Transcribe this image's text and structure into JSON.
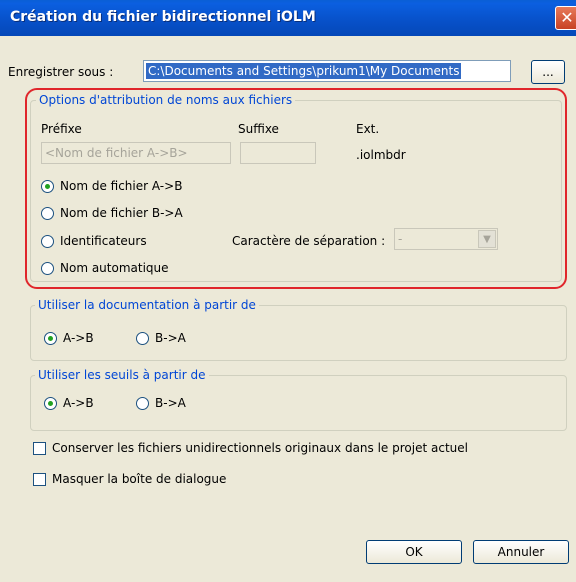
{
  "window": {
    "title": "Création du fichier bidirectionnel iOLM",
    "close_glyph": "✕"
  },
  "save": {
    "label": "Enregistrer sous :",
    "path": "C:\\Documents and Settings\\prikum1\\My Documents",
    "browse_label": "..."
  },
  "naming": {
    "legend": "Options d'attribution de noms aux fichiers",
    "prefix_label": "Préfixe",
    "suffix_label": "Suffixe",
    "ext_label": "Ext.",
    "prefix_value": "<Nom de fichier A->B>",
    "suffix_value": "",
    "ext_value": ".iolmbdr",
    "options": [
      {
        "label": "Nom de fichier A->B",
        "selected": true
      },
      {
        "label": "Nom de fichier B->A",
        "selected": false
      },
      {
        "label": "Identificateurs",
        "selected": false
      },
      {
        "label": "Nom automatique",
        "selected": false
      }
    ],
    "separator_label": "Caractère de séparation :",
    "separator_value": "-"
  },
  "doc": {
    "legend": "Utiliser la documentation à partir de",
    "opt1": "A->B",
    "opt2": "B->A",
    "selected": "A->B"
  },
  "thresholds": {
    "legend": "Utiliser les seuils à partir de",
    "opt1": "A->B",
    "opt2": "B->A",
    "selected": "A->B"
  },
  "checks": {
    "keep_originals": "Conserver les fichiers unidirectionnels originaux dans le projet actuel",
    "hide_dialog": "Masquer la boîte de dialogue"
  },
  "buttons": {
    "ok": "OK",
    "cancel": "Annuler"
  },
  "colors": {
    "accent_blue": "#0046d5",
    "highlight_red": "#e0262b",
    "title_blue": "#0750c8"
  }
}
